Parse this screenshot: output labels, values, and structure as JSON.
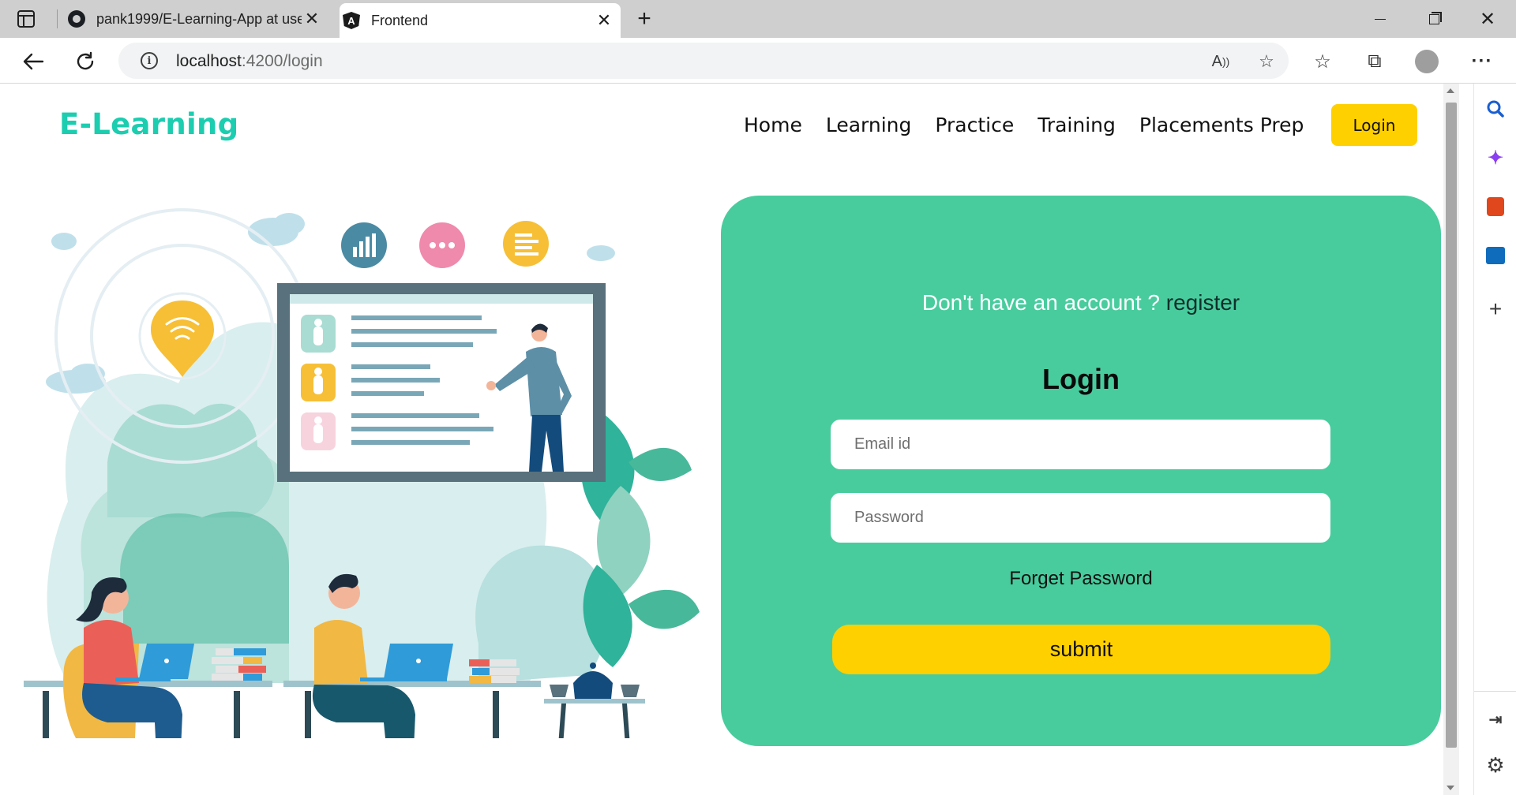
{
  "browser": {
    "tabs": [
      {
        "title": "pank1999/E-Learning-App at use",
        "icon": "github-icon",
        "active": false
      },
      {
        "title": "Frontend",
        "icon": "angular-icon",
        "active": true
      }
    ],
    "new_tab_symbol": "+",
    "close_symbol": "✕",
    "url": {
      "host": "localhost",
      "rest": ":4200/login"
    }
  },
  "site": {
    "brand": "E-Learning",
    "nav": [
      "Home",
      "Learning",
      "Practice",
      "Training",
      "Placements Prep"
    ],
    "nav_login": "Login"
  },
  "login_card": {
    "prompt": "Don't have an account ?",
    "register_link": "register",
    "title": "Login",
    "email_placeholder": "Email id",
    "password_placeholder": "Password",
    "forgot_password": "Forget Password",
    "submit": "submit"
  },
  "colors": {
    "brand": "#1ccdb0",
    "card_bg": "#48cc9e",
    "accent_yellow": "#ffd000"
  }
}
